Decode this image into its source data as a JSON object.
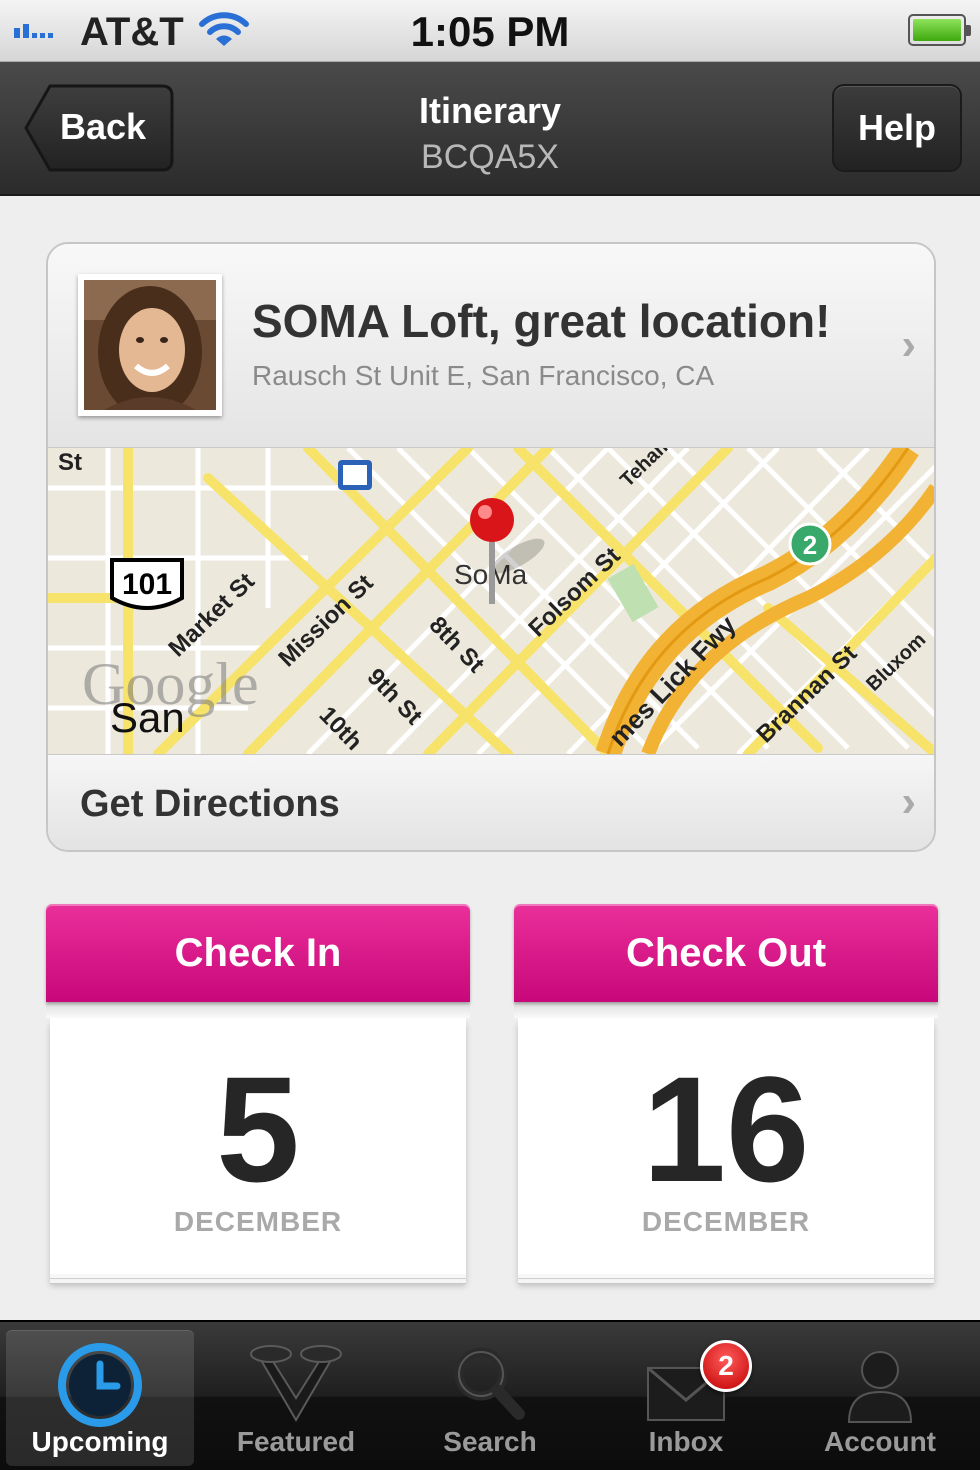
{
  "status_bar": {
    "carrier": "AT&T",
    "time": "1:05 PM",
    "icons": [
      "signal-icon",
      "wifi-icon",
      "battery-icon"
    ],
    "battery_level": 1.0
  },
  "nav": {
    "back_label": "Back",
    "title": "Itinerary",
    "subtitle": "BCQA5X",
    "help_label": "Help"
  },
  "listing": {
    "title": "SOMA Loft, great location!",
    "address": "Rausch St Unit E, San Francisco, CA",
    "chevron": "›"
  },
  "map": {
    "street_labels": [
      "St",
      "Market St",
      "Mission St",
      "8th St",
      "9th St",
      "10th",
      "Folsom St",
      "Brannan St",
      "Bluxom",
      "Tehama",
      "mes Lick Fwy"
    ],
    "highway_shield": "101",
    "route_marker": "2",
    "area_label": "SoMa",
    "city_label": "San",
    "watermark": "Google",
    "pin_icon": "map-pin-icon"
  },
  "directions": {
    "label": "Get Directions",
    "chevron": "›"
  },
  "check_in": {
    "label": "Check In",
    "day": "5",
    "month": "DECEMBER"
  },
  "check_out": {
    "label": "Check Out",
    "day": "16",
    "month": "DECEMBER"
  },
  "tabs": [
    {
      "label": "Upcoming",
      "icon": "clock-icon",
      "active": true
    },
    {
      "label": "Featured",
      "icon": "featured-icon",
      "active": false
    },
    {
      "label": "Search",
      "icon": "search-icon",
      "active": false
    },
    {
      "label": "Inbox",
      "icon": "envelope-icon",
      "active": false,
      "badge": "2"
    },
    {
      "label": "Account",
      "icon": "person-icon",
      "active": false
    }
  ],
  "colors": {
    "accent_magenta": "#d6168a",
    "active_tab_blue": "#2a9be8",
    "badge_red": "#d40000"
  }
}
